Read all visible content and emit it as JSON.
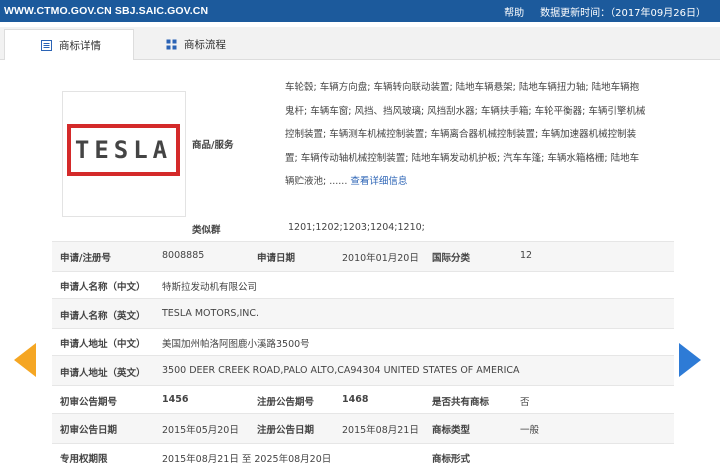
{
  "topbar": {
    "site": "WWW.CTMO.GOV.CN SBJ.SAIC.GOV.CN",
    "help": "帮助",
    "update": "数据更新时间：（2017年09月26日）"
  },
  "tabs": [
    {
      "label": "商标详情"
    },
    {
      "label": "商标流程"
    }
  ],
  "logo_text": "TESLA",
  "goods_label": "商品/服务",
  "goods_lines": [
    "车轮毂; 车辆方向盘; 车辆转向联动装置; 陆地车辆悬架; 陆地车辆扭力轴; 陆地车辆抱",
    "鬼杆; 车辆车窗; 风挡、挡风玻璃; 风挡刮水器; 车辆扶手箱; 车轮平衡器; 车辆引擎机械",
    "控制装置; 车辆测车机械控制装置; 车辆离合器机械控制装置; 车辆加速器机械控制装",
    "置; 车辆传动轴机械控制装置; 陆地车辆发动机护板; 汽车车篷; 车辆水箱格栅; 陆地车",
    "辆贮液池; ......"
  ],
  "goods_more": "查看详细信息",
  "class_label": "类似群",
  "class_value": "1201;1202;1203;1204;1210;",
  "fields": {
    "reg_no_label": "申请/注册号",
    "reg_no": "8008885",
    "app_date_label": "申请日期",
    "app_date": "2010年01月20日",
    "intl_class_label": "国际分类",
    "intl_class": "12",
    "applicant_cn_label": "申请人名称（中文）",
    "applicant_cn": "特斯拉发动机有限公司",
    "applicant_en_label": "申请人名称（英文）",
    "applicant_en": "TESLA MOTORS,INC.",
    "address_cn_label": "申请人地址（中文）",
    "address_cn": "美国加州帕洛阿图鹿小溪路3500号",
    "address_en_label": "申请人地址（英文）",
    "address_en": "3500 DEER CREEK ROAD,PALO ALTO,CA94304 UNITED STATES OF AMERICA",
    "prelim_issue_label": "初审公告期号",
    "prelim_issue": "1456",
    "reg_issue_label": "注册公告期号",
    "reg_issue": "1468",
    "shared_label": "是否共有商标",
    "shared": "否",
    "prelim_date_label": "初审公告日期",
    "prelim_date": "2015年05月20日",
    "reg_date_label": "注册公告日期",
    "reg_date": "2015年08月21日",
    "type_label": "商标类型",
    "type": "一般",
    "excl_period_label": "专用权期限",
    "excl_period": "2015年08月21日 至 2025年08月20日",
    "form_label": "商标形式"
  },
  "colors": {
    "topbar": "#1c5a9c",
    "logo_border": "#d42a2a",
    "arrow_left": "#f5a623",
    "arrow_right": "#2e7bd6",
    "link": "#2b63b5"
  },
  "icons": {
    "tab1": "list-icon",
    "tab2": "grid-icon",
    "prev": "arrow-left-icon",
    "next": "arrow-right-icon"
  }
}
